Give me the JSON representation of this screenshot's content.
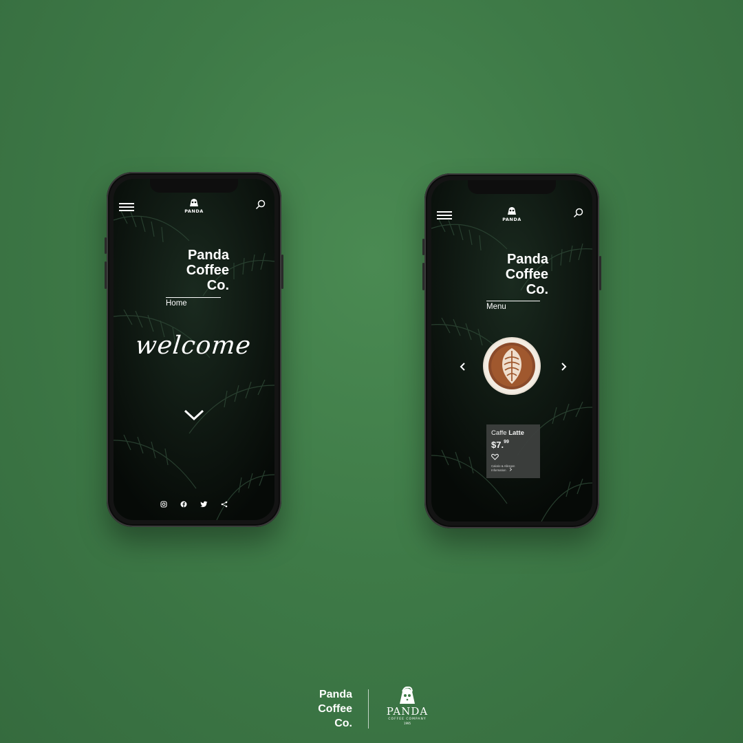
{
  "colors": {
    "background": "#3e7a47",
    "text": "#ffffff",
    "card": "#3d403e"
  },
  "phone_left": {
    "logo": {
      "icon": "panda-icon",
      "word": "PANDA"
    },
    "brand": [
      "Panda",
      "Coffee",
      "Co."
    ],
    "page_label": "Home",
    "welcome": "welcome",
    "scroll_icon": "chevron-down-icon",
    "socials": [
      "instagram-icon",
      "facebook-icon",
      "twitter-icon",
      "share-icon"
    ]
  },
  "phone_right": {
    "logo": {
      "icon": "panda-icon",
      "word": "PANDA"
    },
    "brand": [
      "Panda",
      "Coffee",
      "Co."
    ],
    "page_label": "Menu",
    "product": {
      "name_regular": "Caffe",
      "name_bold": "Latte",
      "price_main": "$7.",
      "price_cents": "99",
      "info_line1": "Calorie & Allergen",
      "info_line2": "Information"
    }
  },
  "footer": {
    "brand": [
      "Panda",
      "Coffee",
      "Co."
    ],
    "logo_word": "PANDA",
    "logo_sub": "COFFEE COMPANY",
    "logo_year": "1995"
  }
}
